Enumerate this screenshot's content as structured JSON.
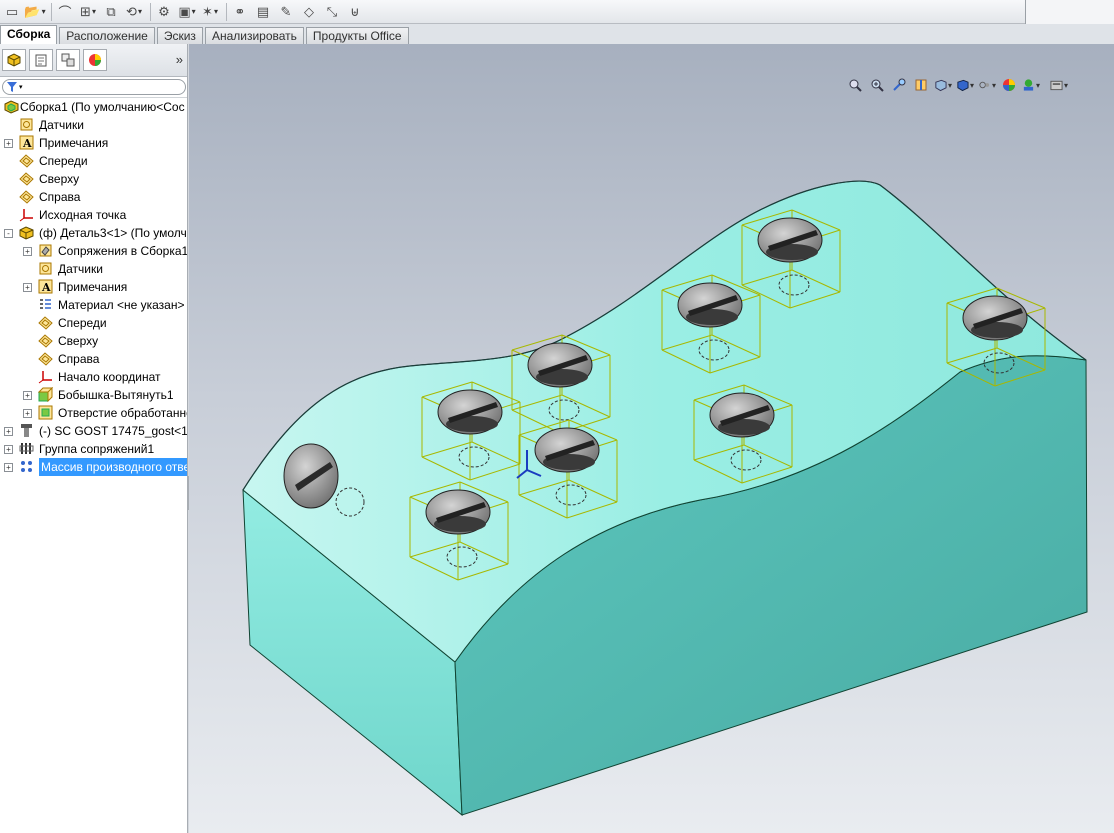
{
  "tabs": [
    "Сборка",
    "Расположение",
    "Эскиз",
    "Анализировать",
    "Продукты Office"
  ],
  "active_tab": "Сборка",
  "toolbar_icons": [
    "new-file-icon",
    "open-icon",
    "paperclip-icon",
    "insert-components-icon",
    "mate-icon",
    "explode-icon",
    "linear-pattern-icon",
    "move-component-icon",
    "smart-fasteners-icon",
    "assembly-features-icon",
    "rebuild-icon",
    "options-icon",
    "edit-component-icon",
    "reference-geometry-icon",
    "flatten-icon"
  ],
  "feature_manager": {
    "tabs": [
      "feature-manager-icon",
      "property-manager-icon",
      "configuration-manager-icon",
      "display-manager-icon"
    ],
    "more": "»",
    "tree": [
      {
        "label": "Сборка1  (По умолчанию<Сос",
        "depth": 0,
        "expand": "-",
        "icon": "assembly-icon"
      },
      {
        "label": "Датчики",
        "depth": 1,
        "expand": "",
        "icon": "sensor-icon"
      },
      {
        "label": "Примечания",
        "depth": 1,
        "expand": "+",
        "icon": "annotation-icon"
      },
      {
        "label": "Спереди",
        "depth": 1,
        "expand": "",
        "icon": "plane-icon"
      },
      {
        "label": "Сверху",
        "depth": 1,
        "expand": "",
        "icon": "plane-icon"
      },
      {
        "label": "Справа",
        "depth": 1,
        "expand": "",
        "icon": "plane-icon"
      },
      {
        "label": "Исходная точка",
        "depth": 1,
        "expand": "",
        "icon": "origin-icon"
      },
      {
        "label": "(ф) Деталь3<1> (По умолч",
        "depth": 1,
        "expand": "-",
        "icon": "part-icon"
      },
      {
        "label": "Сопряжения в Сборка1",
        "depth": 2,
        "expand": "+",
        "icon": "mates-icon"
      },
      {
        "label": "Датчики",
        "depth": 2,
        "expand": "",
        "icon": "sensor-icon"
      },
      {
        "label": "Примечания",
        "depth": 2,
        "expand": "+",
        "icon": "annotation-icon"
      },
      {
        "label": "Материал <не указан>",
        "depth": 2,
        "expand": "",
        "icon": "material-icon"
      },
      {
        "label": "Спереди",
        "depth": 2,
        "expand": "",
        "icon": "plane-icon"
      },
      {
        "label": "Сверху",
        "depth": 2,
        "expand": "",
        "icon": "plane-icon"
      },
      {
        "label": "Справа",
        "depth": 2,
        "expand": "",
        "icon": "plane-icon"
      },
      {
        "label": "Начало координат",
        "depth": 2,
        "expand": "",
        "icon": "origin-icon"
      },
      {
        "label": "Бобышка-Вытянуть1",
        "depth": 2,
        "expand": "+",
        "icon": "extrude-icon"
      },
      {
        "label": "Отверстие обработанно",
        "depth": 2,
        "expand": "+",
        "icon": "hole-wizard-icon"
      },
      {
        "label": "(-) SC GOST 17475_gost<1>",
        "depth": 1,
        "expand": "+",
        "icon": "screw-part-icon"
      },
      {
        "label": "Группа сопряжений1",
        "depth": 1,
        "expand": "+",
        "icon": "mate-group-icon"
      },
      {
        "label": "Массив производного отве",
        "depth": 1,
        "expand": "+",
        "icon": "derived-pattern-icon",
        "selected": true
      }
    ]
  },
  "heads_up_icons": [
    "zoom-to-fit-icon",
    "zoom-to-area-icon",
    "previous-view-icon",
    "section-view-icon",
    "view-orientation-icon",
    "display-style-icon",
    "hide-show-items-icon",
    "edit-appearance-icon",
    "apply-scene-icon",
    "view-settings-icon"
  ],
  "colors": {
    "model_top": "#9ff0e6",
    "model_front": "#4fb8b0",
    "model_side": "#7fe6dc",
    "selection_box": "#a8b800",
    "selected_row": "#3399ff"
  }
}
